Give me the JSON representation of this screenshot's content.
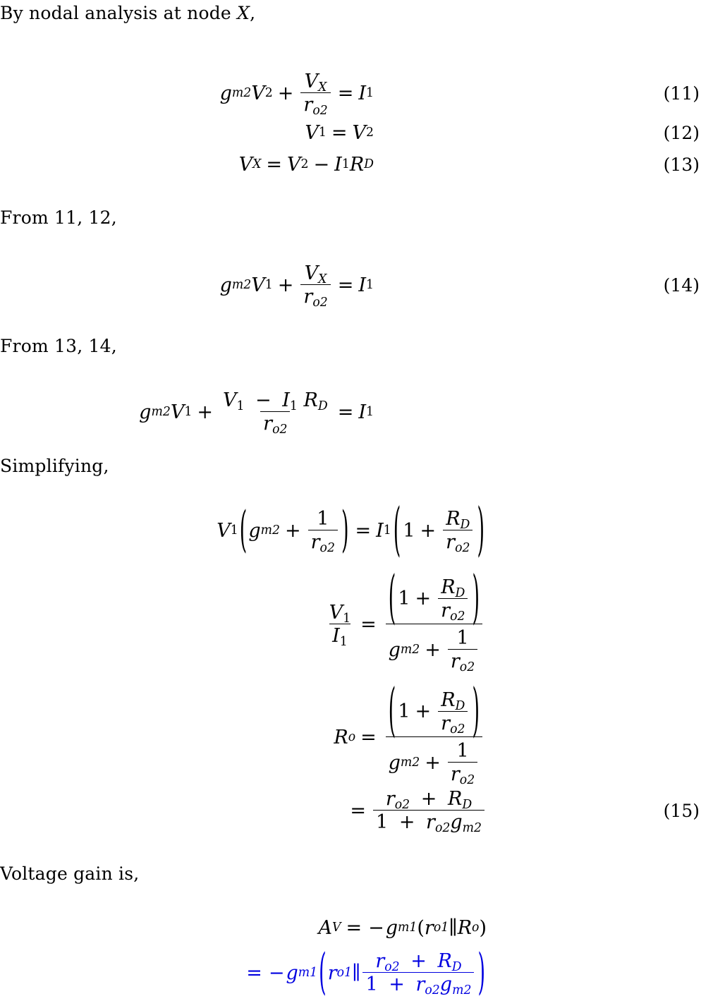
{
  "document": {
    "type": "math-derivation",
    "language": "en",
    "accent_color": "#0000e0",
    "text_color": "#000000",
    "background": "#ffffff"
  },
  "lines": {
    "intro": {
      "prefix": "By nodal analysis at node ",
      "symbol": "X",
      "suffix": ","
    },
    "from_11_12": "From 11, 12,",
    "from_13_14": "From 13, 14,",
    "simplifying": "Simplifying,",
    "voltage_gain": "Voltage gain is,"
  },
  "equations": {
    "eq11": {
      "number": "(11)",
      "latex": "g_{m2}V_2 + \\frac{V_X}{r_{o2}} = I_1",
      "parts": {
        "g": "g",
        "g_sub": "m2",
        "V": "V",
        "V_sub": "2",
        "plus": "+",
        "num_V": "V",
        "num_sub": "X",
        "den_r": "r",
        "den_sub": "o2",
        "eq": "=",
        "I": "I",
        "I_sub": "1"
      }
    },
    "eq12": {
      "number": "(12)",
      "latex": "V_1 = V_2",
      "parts": {
        "lhs_V": "V",
        "lhs_sub": "1",
        "eq": "=",
        "rhs_V": "V",
        "rhs_sub": "2"
      }
    },
    "eq13": {
      "number": "(13)",
      "latex": "V_X = V_2 - I_1 R_D",
      "parts": {
        "lhs_V": "V",
        "lhs_sub": "X",
        "eq": "=",
        "rhs_V": "V",
        "rhs_sub": "2",
        "minus": "−",
        "I": "I",
        "I_sub": "1",
        "R": "R",
        "R_sub": "D"
      }
    },
    "eq14": {
      "number": "(14)",
      "latex": "g_{m2}V_1 + \\frac{V_X}{r_{o2}} = I_1",
      "parts": {
        "g": "g",
        "g_sub": "m2",
        "V": "V",
        "V_sub": "1",
        "plus": "+",
        "num_V": "V",
        "num_sub": "X",
        "den_r": "r",
        "den_sub": "o2",
        "eq": "=",
        "I": "I",
        "I_sub": "1"
      }
    },
    "eq_subst": {
      "number": "",
      "latex": "g_{m2}V_1 + \\frac{V_1 - I_1 R_D}{r_{o2}} = I_1",
      "parts": {
        "g": "g",
        "g_sub": "m2",
        "V": "V",
        "V_sub": "1",
        "plus": "+",
        "num_V": "V",
        "num_V_sub": "1",
        "num_minus": "−",
        "num_I": "I",
        "num_I_sub": "1",
        "num_R": "R",
        "num_R_sub": "D",
        "den_r": "r",
        "den_sub": "o2",
        "eq": "=",
        "I": "I",
        "I_sub": "1"
      }
    },
    "eq_simplify1": {
      "number": "",
      "latex": "V_1(g_{m2} + \\frac{1}{r_{o2}}) = I_1\\left(1 + \\frac{R_D}{r_{o2}}\\right)",
      "parts": {
        "V": "V",
        "V_sub": "1",
        "lparen": "(",
        "g": "g",
        "g_sub": "m2",
        "plus": "+",
        "one": "1",
        "r": "r",
        "r_sub": "o2",
        "rparen": ")",
        "eq": "=",
        "I": "I",
        "I_sub": "1",
        "lparen_big": "(",
        "one2": "1",
        "plus2": "+",
        "R": "R",
        "R_sub": "D",
        "r2": "r",
        "r2_sub": "o2",
        "rparen_big": ")"
      }
    },
    "eq_ratio": {
      "number": "",
      "latex": "\\frac{V_1}{I_1} = \\frac{\\left(1 + \\frac{R_D}{r_{o2}}\\right)}{g_{m2} + \\frac{1}{r_{o2}}}",
      "parts": {
        "lhs_num_V": "V",
        "lhs_num_sub": "1",
        "lhs_den_I": "I",
        "lhs_den_sub": "1",
        "eq": "=",
        "lparen": "(",
        "one": "1",
        "plus": "+",
        "R": "R",
        "R_sub": "D",
        "r": "r",
        "r_sub": "o2",
        "rparen": ")",
        "g": "g",
        "g_sub": "m2",
        "plus2": "+",
        "one2": "1",
        "r2": "r",
        "r2_sub": "o2"
      }
    },
    "eq_ro": {
      "number": "",
      "latex": "R_o = \\frac{\\left(1 + \\frac{R_D}{r_{o2}}\\right)}{g_{m2} + \\frac{1}{r_{o2}}}",
      "parts": {
        "R_o": "R",
        "R_o_sub": "o",
        "eq": "=",
        "lparen": "(",
        "one": "1",
        "plus": "+",
        "R": "R",
        "R_sub": "D",
        "r": "r",
        "r_sub": "o2",
        "rparen": ")",
        "g": "g",
        "g_sub": "m2",
        "plus2": "+",
        "one2": "1",
        "r2": "r",
        "r2_sub": "o2"
      }
    },
    "eq15": {
      "number": "(15)",
      "latex": "= \\frac{r_{o2} + R_D}{1 + r_{o2}g_{m2}}",
      "parts": {
        "eq": "=",
        "num_r": "r",
        "num_r_sub": "o2",
        "num_plus": "+",
        "num_R": "R",
        "num_R_sub": "D",
        "den_one": "1",
        "den_plus": "+",
        "den_r": "r",
        "den_r_sub": "o2",
        "den_g": "g",
        "den_g_sub": "m2"
      }
    },
    "eq_av": {
      "number": "",
      "latex": "A_V = -g_{m1}(r_{o1} \\| R_o)",
      "parts": {
        "A": "A",
        "A_sub": "V",
        "eq": "=",
        "minus": "−",
        "g": "g",
        "g_sub": "m1",
        "lparen": "(",
        "r": "r",
        "r_sub": "o1",
        "par": "∥",
        "R": "R",
        "R_sub": "o",
        "rparen": ")"
      }
    },
    "eq_av_final": {
      "number": "",
      "color": "#0000e0",
      "latex": "= -g_{m1}(r_{o1} \\| \\frac{r_{o2} + R_D}{1 + r_{o2}g_{m2}})",
      "parts": {
        "eq": "=",
        "minus": "−",
        "g": "g",
        "g_sub": "m1",
        "lparen": "(",
        "r": "r",
        "r_sub": "o1",
        "par": "∥",
        "num_r": "r",
        "num_r_sub": "o2",
        "num_plus": "+",
        "num_R": "R",
        "num_R_sub": "D",
        "den_one": "1",
        "den_plus": "+",
        "den_r": "r",
        "den_r_sub": "o2",
        "den_g": "g",
        "den_g_sub": "m2",
        "rparen": ")"
      }
    }
  }
}
